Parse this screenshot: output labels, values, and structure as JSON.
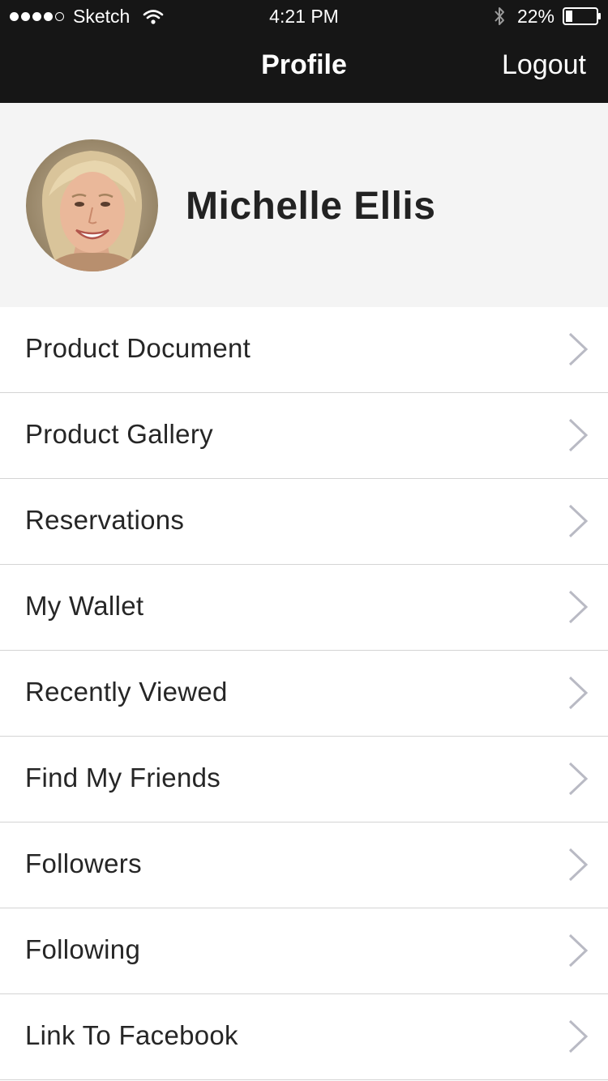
{
  "status_bar": {
    "carrier": "Sketch",
    "time": "4:21 PM",
    "battery_percent": "22%",
    "battery_level": 0.22,
    "signal_bars_filled": 4,
    "signal_bars_total": 5
  },
  "nav": {
    "title": "Profile",
    "logout_label": "Logout"
  },
  "profile": {
    "name": "Michelle Ellis"
  },
  "menu": {
    "items": [
      {
        "label": "Product Document",
        "icon": "chevron-right-icon"
      },
      {
        "label": "Product Gallery",
        "icon": "chevron-right-icon"
      },
      {
        "label": "Reservations",
        "icon": "chevron-right-icon"
      },
      {
        "label": "My Wallet",
        "icon": "chevron-right-icon"
      },
      {
        "label": "Recently Viewed",
        "icon": "chevron-right-icon"
      },
      {
        "label": "Find My Friends",
        "icon": "chevron-right-icon"
      },
      {
        "label": "Followers",
        "icon": "chevron-right-icon"
      },
      {
        "label": "Following",
        "icon": "chevron-right-icon"
      },
      {
        "label": "Link To Facebook",
        "icon": "chevron-right-icon"
      }
    ]
  },
  "colors": {
    "bar_background": "#161616",
    "header_background": "#f4f4f4",
    "chevron": "#b9bac4",
    "divider": "#d4d4d4"
  }
}
